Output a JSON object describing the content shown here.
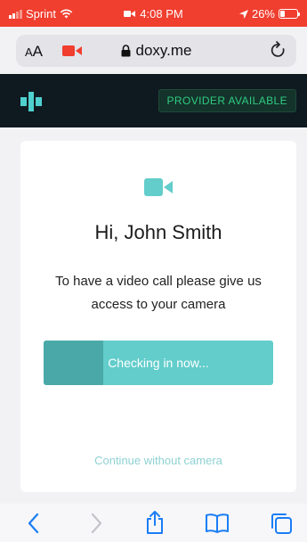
{
  "status_bar": {
    "carrier": "Sprint",
    "time": "4:08 PM",
    "battery_percent": "26%",
    "battery_level": 0.26,
    "background_color": "#f03e2f"
  },
  "browser": {
    "text_size_label": "AA",
    "domain": "doxy.me",
    "icons": [
      "camera-in-use-icon",
      "lock-icon",
      "reload-icon"
    ]
  },
  "app_header": {
    "logo_icon": "doxy-logo-icon",
    "provider_status": "PROVIDER AVAILABLE",
    "status_color": "#2fcc83"
  },
  "checkin_card": {
    "icon": "video-camera-icon",
    "greeting": "Hi, John Smith",
    "instructions": "To have a video call please give us access to your camera",
    "checkin_button_label": "Checking in now...",
    "checkin_progress": 0.26,
    "skip_camera_link": "Continue without camera",
    "accent_color": "#62cdcb"
  },
  "toolbar": {
    "icons": [
      "back-icon",
      "forward-icon",
      "share-icon",
      "bookmarks-icon",
      "tabs-icon"
    ]
  }
}
